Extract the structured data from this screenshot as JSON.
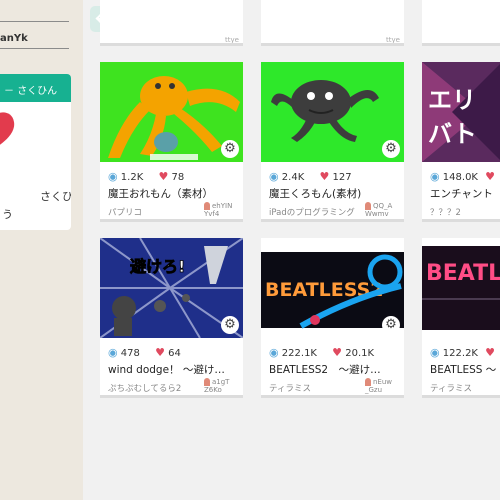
{
  "sidebar": {
    "username": "anYk",
    "card_header": "さくひん",
    "card_line1": "さくひん",
    "card_line2": "う"
  },
  "top_cards": [
    "ttye",
    "ttye",
    ""
  ],
  "cards": [
    {
      "views": "1.2K",
      "likes": "78",
      "title": "魔王おれもん（素材）",
      "author": "パプリコ",
      "uid": "ehYIN Yvf4"
    },
    {
      "views": "2.4K",
      "likes": "127",
      "title": "魔王くろもん(素材)",
      "author": "iPadのプログラミング",
      "uid": "QQ_A Wwmv"
    },
    {
      "views": "148.0K",
      "likes": "",
      "title": "エンチャント",
      "author": "？？？2",
      "uid": ""
    },
    {
      "views": "478",
      "likes": "64",
      "title": "wind dodge！ ～避け…",
      "author": "ぷちぷむしてるら2",
      "uid": "a1gT Z6Ko"
    },
    {
      "views": "222.1K",
      "likes": "20.1K",
      "title": "BEATLESS2　～避け…",
      "author": "ティラミス",
      "uid": "nEuw _Gzu"
    },
    {
      "views": "122.2K",
      "likes": "",
      "title": "BEATLESS ～",
      "author": "ティラミス",
      "uid": ""
    }
  ],
  "thumb_text": {
    "dodge": "避けろ!",
    "beatless2": "BEATLESS2",
    "beatless": "BEATL"
  }
}
